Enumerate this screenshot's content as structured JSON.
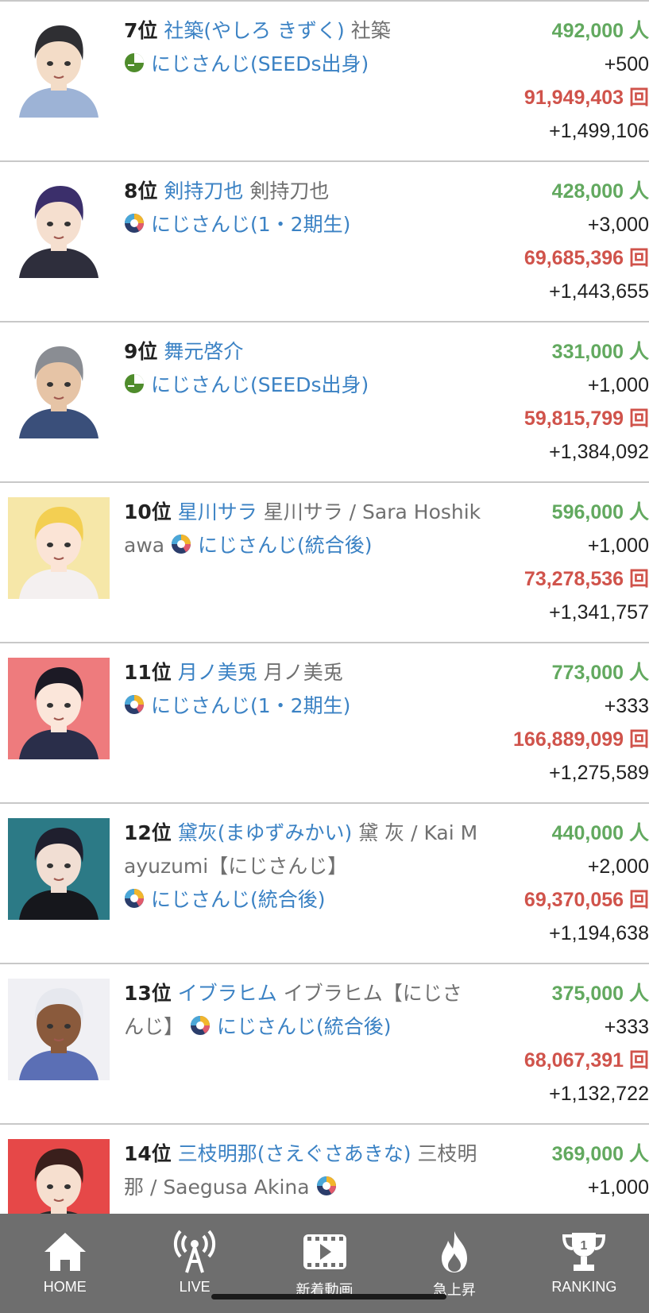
{
  "entries": [
    {
      "rank": "7位",
      "name": "社築(やしろ きずく)",
      "sub": "社築",
      "group": "にじさんじ(SEEDs出身)",
      "group_icon": "seeds-icon",
      "subscribers": "492,000 人",
      "sub_delta": "+500",
      "views": "91,949,403 回",
      "view_delta": "+1,499,106",
      "avatar": {
        "bg": "#ffffff",
        "hair": "#2f2f33",
        "skin": "#f3dcc7",
        "cloth": "#9db3d6"
      }
    },
    {
      "rank": "8位",
      "name": "剣持刀也",
      "sub": "剣持刀也",
      "group": "にじさんじ(1・2期生)",
      "group_icon": "nijisanji-icon",
      "subscribers": "428,000 人",
      "sub_delta": "+3,000",
      "views": "69,685,396 回",
      "view_delta": "+1,443,655",
      "avatar": {
        "bg": "#ffffff",
        "hair": "#3b2f6b",
        "skin": "#f5dfcf",
        "cloth": "#2e2e3c"
      }
    },
    {
      "rank": "9位",
      "name": "舞元啓介",
      "sub": "",
      "group": "にじさんじ(SEEDs出身)",
      "group_icon": "seeds-icon",
      "subscribers": "331,000 人",
      "sub_delta": "+1,000",
      "views": "59,815,799 回",
      "view_delta": "+1,384,092",
      "avatar": {
        "bg": "#ffffff",
        "hair": "#8a8d93",
        "skin": "#e6c4a6",
        "cloth": "#3a4f7a"
      }
    },
    {
      "rank": "10位",
      "name": "星川サラ",
      "sub": "星川サラ / Sara Hoshikawa",
      "group": "にじさんじ(統合後)",
      "group_icon": "nijisanji-icon",
      "subscribers": "596,000 人",
      "sub_delta": "+1,000",
      "views": "73,278,536 回",
      "view_delta": "+1,341,757",
      "avatar": {
        "bg": "#f6e7a8",
        "hair": "#f3cf52",
        "skin": "#fbe4d6",
        "cloth": "#f4f0f0"
      }
    },
    {
      "rank": "11位",
      "name": "月ノ美兎",
      "sub": "月ノ美兎",
      "group": "にじさんじ(1・2期生)",
      "group_icon": "nijisanji-icon",
      "subscribers": "773,000 人",
      "sub_delta": "+333",
      "views": "166,889,099 回",
      "view_delta": "+1,275,589",
      "avatar": {
        "bg": "#ee7b7d",
        "hair": "#1c1a25",
        "skin": "#fbe6da",
        "cloth": "#2a2e4a"
      }
    },
    {
      "rank": "12位",
      "name": "黛灰(まゆずみかい)",
      "sub": "黛 灰 / Kai Mayuzumi【にじさんじ】",
      "group": "にじさんじ(統合後)",
      "group_icon": "nijisanji-icon",
      "subscribers": "440,000 人",
      "sub_delta": "+2,000",
      "views": "69,370,056 回",
      "view_delta": "+1,194,638",
      "avatar": {
        "bg": "#2c7a86",
        "hair": "#1f1f2e",
        "skin": "#f1ded3",
        "cloth": "#16171c"
      }
    },
    {
      "rank": "13位",
      "name": "イブラヒム",
      "sub": "イブラヒム【にじさんじ】",
      "group": "にじさんじ(統合後)",
      "group_icon": "nijisanji-icon",
      "subscribers": "375,000 人",
      "sub_delta": "+333",
      "views": "68,067,391 回",
      "view_delta": "+1,132,722",
      "avatar": {
        "bg": "#f0f0f4",
        "hair": "#e6e8ee",
        "skin": "#8a5a3c",
        "cloth": "#5b6fb5"
      }
    },
    {
      "rank": "14位",
      "name": "三枝明那(さえぐさあきな)",
      "sub": "三枝明那 / Saegusa Akina",
      "group": "",
      "group_icon": "nijisanji-icon",
      "subscribers": "369,000 人",
      "sub_delta": "+1,000",
      "views": "",
      "view_delta": "",
      "avatar": {
        "bg": "#e64848",
        "hair": "#3a1f1c",
        "skin": "#f6dfcf",
        "cloth": "#2b2b2b"
      }
    }
  ],
  "nav": [
    {
      "label": "HOME",
      "icon": "home-icon"
    },
    {
      "label": "LIVE",
      "icon": "broadcast-antenna-icon"
    },
    {
      "label": "新着動画",
      "icon": "video-play-icon"
    },
    {
      "label": "急上昇",
      "icon": "flame-icon"
    },
    {
      "label": "RANKING",
      "icon": "trophy-icon"
    }
  ],
  "colors": {
    "link": "#3b82c4",
    "subscribers": "#62a95f",
    "views": "#d0534b",
    "nav_bg": "#6e6e6e"
  }
}
